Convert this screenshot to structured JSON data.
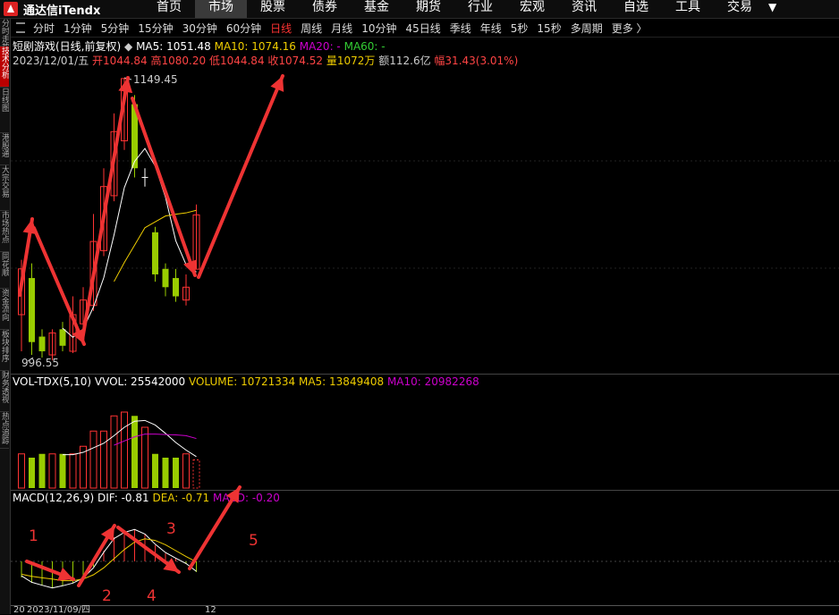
{
  "app": {
    "title": "通达信iTendx"
  },
  "nav": {
    "items": [
      "首页",
      "市场",
      "股票",
      "债券",
      "基金",
      "期货",
      "行业",
      "宏观",
      "资讯",
      "自选",
      "工具",
      "交易"
    ],
    "active": 1
  },
  "sidebar": {
    "tabs": [
      "分时走势",
      "技术分析",
      "日线图",
      "港股通",
      "大宗交易",
      "市场热点",
      "同花顺",
      "资金流向",
      "板块排序",
      "财务透视",
      "热点追踪"
    ]
  },
  "periods": {
    "items": [
      "分时",
      "1分钟",
      "5分钟",
      "15分钟",
      "30分钟",
      "60分钟",
      "日线",
      "周线",
      "月线",
      "10分钟",
      "45日线",
      "季线",
      "年线",
      "5秒",
      "15秒",
      "多周期",
      "更多 〉"
    ],
    "active": 6
  },
  "price_panel": {
    "name": "短剧游戏(日线,前复权)",
    "ma5": "MA5: 1051.48",
    "ma10": "MA10: 1074.16",
    "ma20": "MA20: -",
    "ma60": "MA60: -",
    "date": "2023/12/01/五",
    "open": "开1044.84",
    "high": "高1080.20",
    "low": "低1044.84",
    "close": "收1074.52",
    "volume": "量1072万",
    "amount": "额112.6亿",
    "change": "幅31.43(3.01%)",
    "max_label": "1149.45",
    "min_label": "996.55"
  },
  "volume_panel": {
    "name": "VOL-TDX(5,10)",
    "vvol": "VVOL: 25542000",
    "volume": "VOLUME: 10721334",
    "ma5": "MA5: 13849408",
    "ma10": "MA10: 20982268"
  },
  "macd_panel": {
    "name": "MACD(12,26,9)",
    "dif": "DIF: -0.81",
    "dea": "DEA: -0.71",
    "macd": "MACD: -0.20"
  },
  "annotations": [
    "1",
    "2",
    "3",
    "4",
    "5"
  ],
  "bottom": {
    "start": "20",
    "date": "2023/11/09/四",
    "end": "12"
  },
  "colors": {
    "up": "#ff3333",
    "down": "#99cc00",
    "ma5": "#ffffff",
    "ma10": "#eecc00",
    "ma20": "#cc00cc",
    "arrow": "#ee3333"
  },
  "chart_data": {
    "type": "candlestick",
    "ylim": [
      996.55,
      1149.45
    ],
    "candles": [
      {
        "open": 1020,
        "close": 1045,
        "high": 1050,
        "low": 1000,
        "dir": "up"
      },
      {
        "open": 1040,
        "close": 1005,
        "high": 1048,
        "low": 998,
        "dir": "down"
      },
      {
        "open": 1008,
        "close": 1000,
        "high": 1012,
        "low": 996.55,
        "dir": "down"
      },
      {
        "open": 998,
        "close": 1010,
        "high": 1012,
        "low": 995,
        "dir": "up"
      },
      {
        "open": 1012,
        "close": 1003,
        "high": 1016,
        "low": 1000,
        "dir": "down"
      },
      {
        "open": 1000,
        "close": 1020,
        "high": 1030,
        "low": 999,
        "dir": "up"
      },
      {
        "open": 1015,
        "close": 1028,
        "high": 1035,
        "low": 1012,
        "dir": "up"
      },
      {
        "open": 1025,
        "close": 1060,
        "high": 1075,
        "low": 1022,
        "dir": "up"
      },
      {
        "open": 1055,
        "close": 1090,
        "high": 1100,
        "low": 1052,
        "dir": "up"
      },
      {
        "open": 1085,
        "close": 1120,
        "high": 1130,
        "low": 1082,
        "dir": "up"
      },
      {
        "open": 1115,
        "close": 1149,
        "high": 1149.45,
        "low": 1110,
        "dir": "up"
      },
      {
        "open": 1135,
        "close": 1100,
        "high": 1140,
        "low": 1095,
        "dir": "down"
      },
      {
        "open": 1094,
        "close": 1095,
        "high": 1100,
        "low": 1090,
        "dir": "flat"
      },
      {
        "open": 1065,
        "close": 1042,
        "high": 1068,
        "low": 1038,
        "dir": "down"
      },
      {
        "open": 1045,
        "close": 1035,
        "high": 1048,
        "low": 1030,
        "dir": "down"
      },
      {
        "open": 1040,
        "close": 1030,
        "high": 1045,
        "low": 1027,
        "dir": "down"
      },
      {
        "open": 1028,
        "close": 1035,
        "high": 1042,
        "low": 1025,
        "dir": "up"
      },
      {
        "open": 1044.84,
        "close": 1074.52,
        "high": 1080.2,
        "low": 1044.84,
        "dir": "up"
      }
    ],
    "volumes": [
      {
        "v": 0.45,
        "dir": "up"
      },
      {
        "v": 0.4,
        "dir": "down"
      },
      {
        "v": 0.45,
        "dir": "down"
      },
      {
        "v": 0.45,
        "dir": "up"
      },
      {
        "v": 0.45,
        "dir": "down"
      },
      {
        "v": 0.45,
        "dir": "up"
      },
      {
        "v": 0.55,
        "dir": "up"
      },
      {
        "v": 0.75,
        "dir": "up"
      },
      {
        "v": 0.75,
        "dir": "up"
      },
      {
        "v": 0.95,
        "dir": "up"
      },
      {
        "v": 1.0,
        "dir": "up"
      },
      {
        "v": 0.95,
        "dir": "down"
      },
      {
        "v": 0.8,
        "dir": "up"
      },
      {
        "v": 0.45,
        "dir": "down"
      },
      {
        "v": 0.4,
        "dir": "down"
      },
      {
        "v": 0.4,
        "dir": "down"
      },
      {
        "v": 0.45,
        "dir": "up"
      },
      {
        "v": 0.37,
        "dir": "up"
      }
    ],
    "macd": [
      -0.3,
      -0.4,
      -0.45,
      -0.5,
      -0.45,
      -0.4,
      -0.3,
      -0.1,
      0.2,
      0.45,
      0.55,
      0.6,
      0.5,
      0.3,
      0.15,
      0.05,
      -0.05,
      -0.2
    ]
  }
}
